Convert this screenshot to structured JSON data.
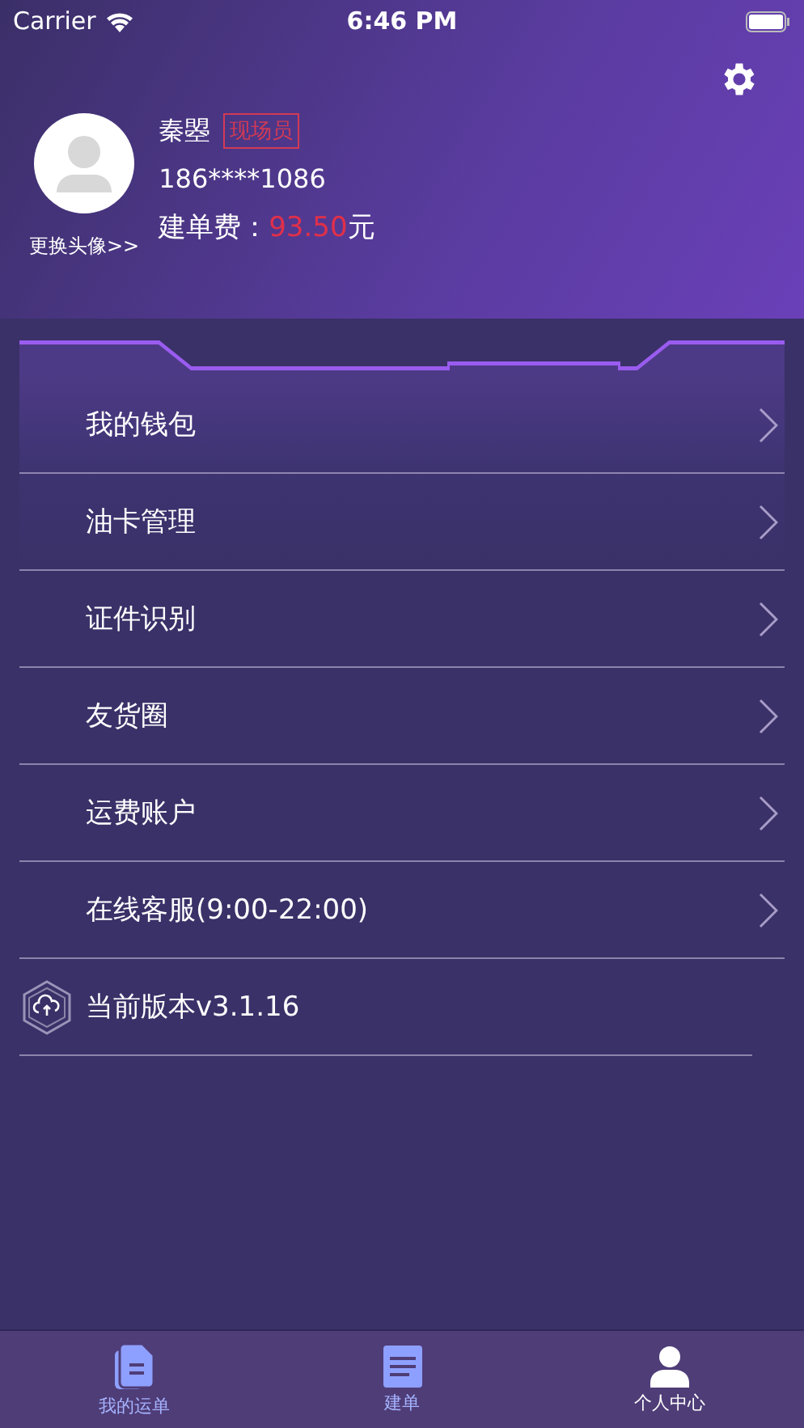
{
  "status_bar": {
    "carrier": "Carrier",
    "time": "6:46 PM"
  },
  "profile": {
    "change_avatar": "更换头像>>",
    "name": "秦曌",
    "role_badge": "现场员",
    "phone": "186****1086",
    "fee_label": "建单费：",
    "fee_amount": "93.50",
    "fee_unit": "元"
  },
  "menu": [
    {
      "label": "我的钱包",
      "kind": "link"
    },
    {
      "label": "油卡管理",
      "kind": "link"
    },
    {
      "label": "证件识别",
      "kind": "link"
    },
    {
      "label": "友货圈",
      "kind": "link"
    },
    {
      "label": "运费账户",
      "kind": "link"
    },
    {
      "label": "在线客服(9:00-22:00)",
      "kind": "link"
    },
    {
      "label": "当前版本v3.1.16",
      "kind": "version"
    }
  ],
  "tab_bar": [
    {
      "label": "我的运单",
      "selected": false,
      "kind": "docs"
    },
    {
      "label": "建单",
      "selected": false,
      "kind": "note"
    },
    {
      "label": "个人中心",
      "selected": true,
      "kind": "person"
    }
  ]
}
